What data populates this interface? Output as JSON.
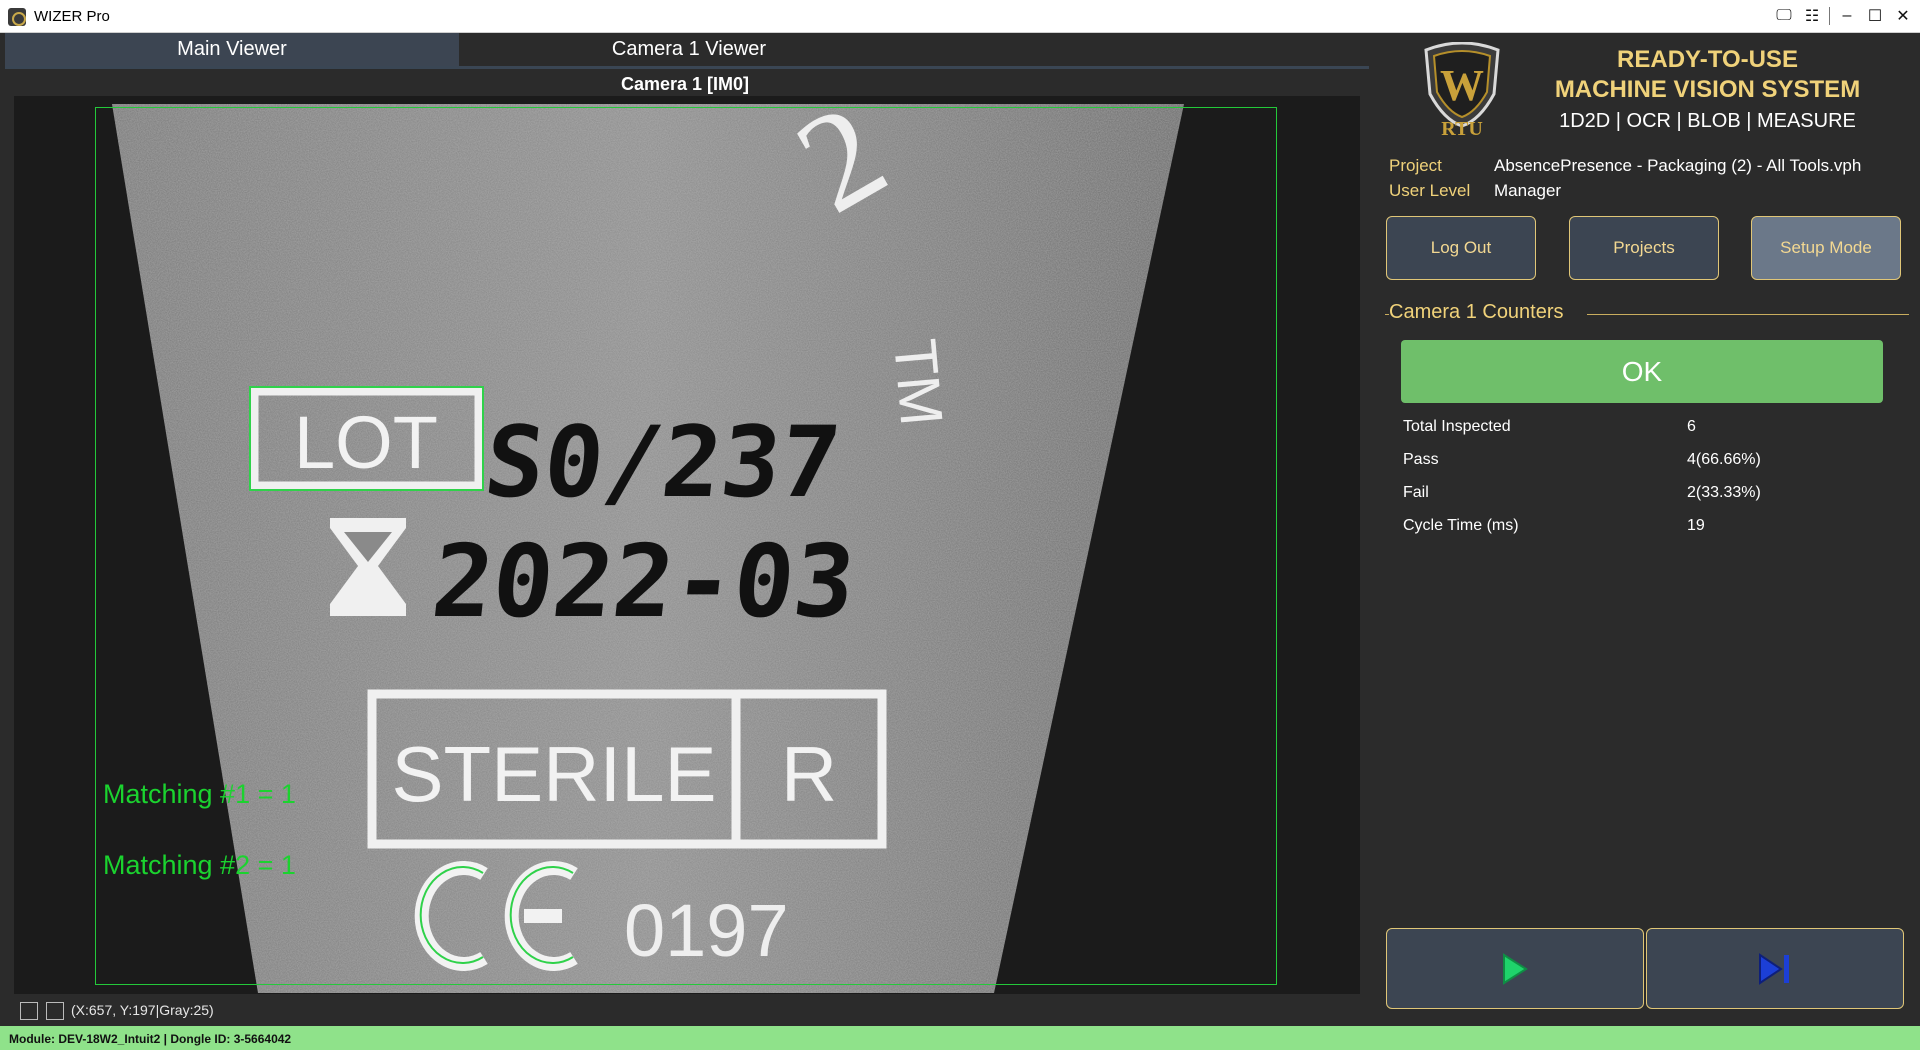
{
  "window": {
    "title": "WIZER Pro",
    "controls": [
      "monitor-icon",
      "equalizer-icon",
      "minimize-icon",
      "maximize-icon",
      "close-icon"
    ]
  },
  "tabs": [
    {
      "label": "Main Viewer",
      "active": true
    },
    {
      "label": "Camera 1 Viewer",
      "active": false
    }
  ],
  "viewer": {
    "title": "Camera 1  [IM0]",
    "image_text": {
      "top_line": "S0/237",
      "date": "2022-03",
      "box_label": "LOT",
      "sterile": "STERILE",
      "r_mark": "R",
      "ce_number": "0197",
      "tm": "TM",
      "script_digit": "2"
    },
    "matches": [
      "Matching #1 = 1",
      "Matching #2 = 1"
    ],
    "cursor_readout": "(X:657, Y:197|Gray:25)",
    "overlay_color": "#24c93a"
  },
  "brand": {
    "logo_letters": "W",
    "logo_caption": "RTU",
    "line1": "READY-TO-USE",
    "line2": "MACHINE VISION SYSTEM",
    "tools": "1D2D | OCR | BLOB | MEASURE"
  },
  "info": {
    "project_label": "Project",
    "project_value": "AbsencePresence - Packaging (2) - All Tools.vph",
    "user_label": "User Level",
    "user_value": "Manager"
  },
  "buttons": {
    "logout": "Log Out",
    "projects": "Projects",
    "setup": "Setup Mode"
  },
  "counters": {
    "title": "Camera 1 Counters",
    "result": "OK",
    "result_color": "#6fbf6a",
    "rows": [
      {
        "label": "Total Inspected",
        "value": "6"
      },
      {
        "label": "Pass",
        "value": "4(66.66%)"
      },
      {
        "label": "Fail",
        "value": "2(33.33%)"
      },
      {
        "label": "Cycle Time (ms)",
        "value": "19"
      }
    ]
  },
  "run_controls": [
    "play-icon",
    "step-icon"
  ],
  "statusbar": {
    "text": "Module: DEV-18W2_Intuit2 | Dongle ID: 3-5664042"
  },
  "colors": {
    "accent_gold": "#f0d27a",
    "panel_dark": "#2b2b2b",
    "tab_active": "#3c4552",
    "status_green": "#8fe28a"
  }
}
